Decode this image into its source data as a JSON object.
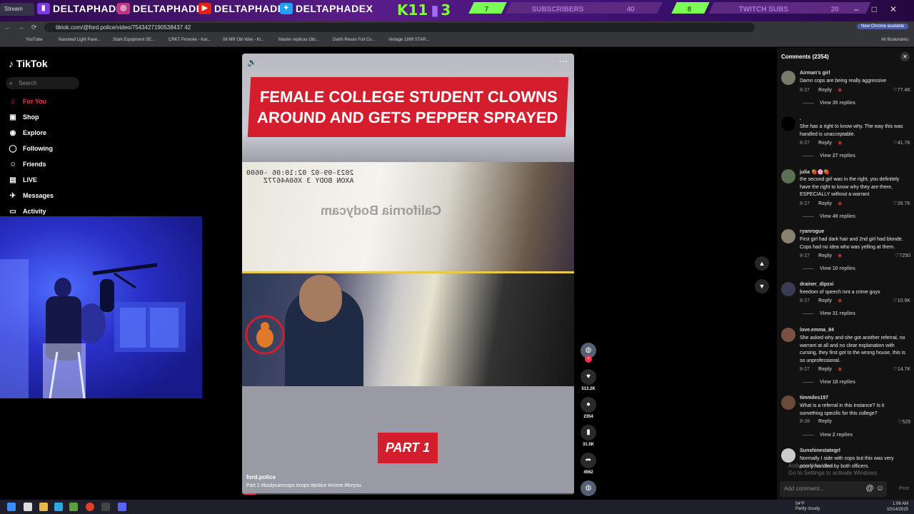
{
  "stream": {
    "tab_title": "Stream",
    "socials": [
      "DELTAPHADE",
      "DELTAPHADE",
      "DELTAPHADE",
      "DELTAPHADEX"
    ],
    "logo_text": "K11",
    "logo_num": "3",
    "subscribers_label": "SUBSCRIBERS",
    "subscribers_current": "7",
    "subscribers_goal": "40",
    "twitch_subs_label": "TWITCH SUBS",
    "twitch_current": "8",
    "twitch_goal": "20"
  },
  "browser": {
    "url": "tiktok.com/@ford.police/video/7543427190538437 42",
    "chrome_badge": "New Chrome available",
    "bookmarks": [
      "YouTube",
      "Nanoleaf Light Pane...",
      "Stark Equipment SE...",
      "CRKT Provoke - Kar...",
      "06 MR Obi Wan - Ki...",
      "Master replicas Obi...",
      "Darth Revan Full Co...",
      "Vintage 1999 STAR...",
      "All Bookmarks"
    ]
  },
  "sidebar": {
    "logo": "TikTok",
    "search_placeholder": "Search",
    "items": [
      {
        "label": "For You",
        "icon": "home-icon"
      },
      {
        "label": "Shop",
        "icon": "shop-icon"
      },
      {
        "label": "Explore",
        "icon": "compass-icon"
      },
      {
        "label": "Following",
        "icon": "following-icon"
      },
      {
        "label": "Friends",
        "icon": "friends-icon"
      },
      {
        "label": "LIVE",
        "icon": "live-icon"
      },
      {
        "label": "Messages",
        "icon": "messages-icon"
      },
      {
        "label": "Activity",
        "icon": "activity-icon"
      }
    ]
  },
  "video": {
    "headline": "FEMALE COLLEGE STUDENT CLOWNS AROUND AND GETS PEPPER SPRAYED",
    "timestamp_line1": "2023-09-02 02:10:06 -0600",
    "timestamp_line2": "AXON BODY 3 X60A4677Z",
    "watermark": "California Bodycam",
    "part_label": "PART 1",
    "username": "ford.police",
    "caption": "Part 1 #bodycamcops #cops #police #crime #foryou",
    "progress_fraction": 0.04
  },
  "actions": {
    "likes": "513.2K",
    "comments": "2354",
    "saves": "31.5K",
    "shares": "4562"
  },
  "comments": {
    "header": "Comments (2354)",
    "reply_label": "Reply",
    "input_placeholder": "Add comment...",
    "post_label": "Post",
    "list": [
      {
        "name": "Airman's girl",
        "text": "Damn cops are being really aggressive",
        "date": "8-27",
        "likes": "77.4K",
        "replies": "View 35 replies"
      },
      {
        "name": ".",
        "text": "She has a right to know why. The way this was handled is unacceptable.",
        "date": "8-27",
        "likes": "41.7K",
        "replies": "View 27 replies"
      },
      {
        "name": "julia 🍓🌸🍓",
        "text": "the second girl was in the right, you definitely have the right to know why they are there, ESPECIALLY without a warrant",
        "date": "8-27",
        "likes": "26.7K",
        "replies": "View 49 replies"
      },
      {
        "name": "ryanrogue",
        "text": "First girl had dark hair and 2nd girl had blonde. Cops had no idea who was yelling at them.",
        "date": "8-27",
        "likes": "7250",
        "replies": "View 10 replies"
      },
      {
        "name": "drainer_dipzxi",
        "text": "freedom of speech isnt a crime guys",
        "date": "8-27",
        "likes": "10.9K",
        "replies": "View 31 replies"
      },
      {
        "name": "love.emma_84",
        "text": "She asked why and she got another referral, no warrant at all and no clear explanation with cursing, they first got to the wrong house, this is so unprofessional.",
        "date": "8-27",
        "likes": "14.7K",
        "replies": "View 18 replies"
      },
      {
        "name": "timmiles197",
        "text": "What is a referral in this instance? Is it something specific for this college?",
        "date": "8-28",
        "likes": "529",
        "replies": "View 2 replies"
      },
      {
        "name": "Sunshinestategrl",
        "text": "Normally I side with cops but this was very poorly handled by both officers.",
        "date": "",
        "likes": "",
        "replies": ""
      }
    ]
  },
  "windows": {
    "activate_line1": "Activate Windows",
    "activate_line2": "Go to Settings to activate Windows.",
    "weather_temp": "54°F",
    "weather_desc": "Partly cloudy",
    "time": "1:06 AM",
    "date": "10/14/2025"
  },
  "colors": {
    "accent": "#ff2d55",
    "headline_red": "#d41e2d",
    "panel": "#121212"
  }
}
